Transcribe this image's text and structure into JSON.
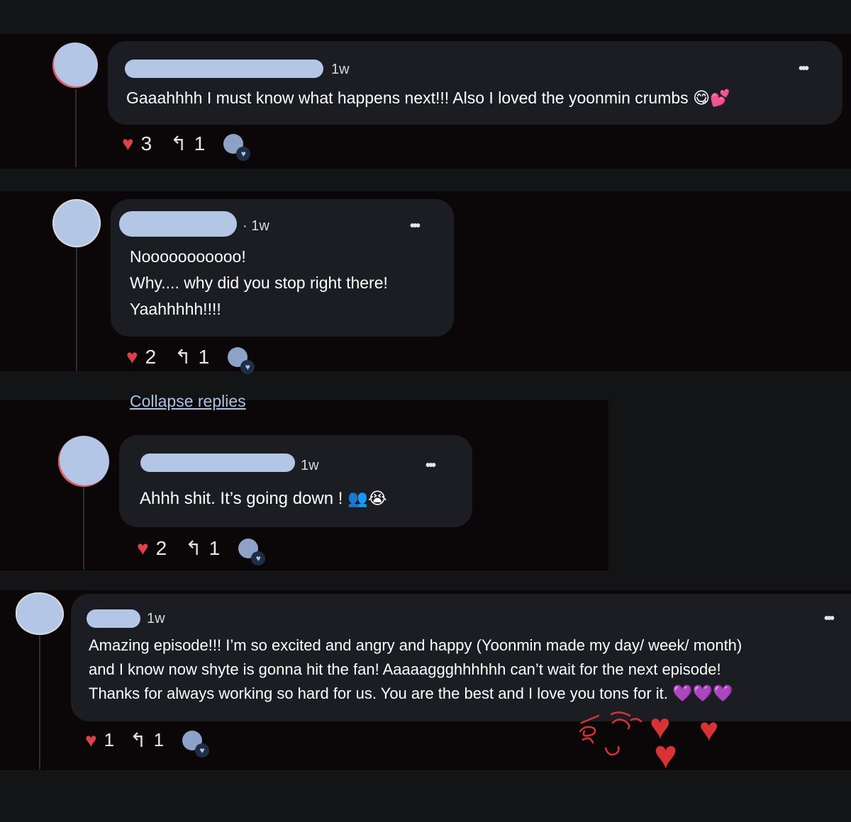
{
  "comments": [
    {
      "time": "1w",
      "text": "Gaaahhhh I must know what happens next!!! Also I loved the yoonmin crumbs",
      "emoji": "😋💕",
      "likes": "3",
      "replies": "1"
    },
    {
      "time": "· 1w",
      "lines": [
        "Nooooooooooo!",
        "Why.... why did you stop right there!",
        "Yaahhhhh!!!!"
      ],
      "likes": "2",
      "replies": "1"
    },
    {
      "time": "1w",
      "text": "Ahhh shit. It’s going down !",
      "emoji": "👥😭",
      "likes": "2",
      "replies": "1"
    },
    {
      "time": "1w",
      "lines": [
        "Amazing episode!!! I’m so excited and angry and happy (Yoonmin made my day/ week/ month)",
        "and I know now shyte is gonna hit the fan! Aaaaaggghhhhhh can’t wait for the next episode!",
        "Thanks for always working so hard for us. You are the best and I love you tons for it."
      ],
      "emoji": "💜💜💜",
      "likes": "1",
      "replies": "1"
    }
  ],
  "collapse_label": "Collapse replies",
  "more_glyph": "•••",
  "heart_glyph": "♥",
  "reply_glyph": "↰",
  "badge_glyph": "♥",
  "colors": {
    "background": "#131416",
    "band": "#0b0709",
    "bubble": "#1c1d22",
    "redaction": "#b3c6e6",
    "like_heart": "#e04146",
    "link": "#a9c2e8",
    "doodle": "#d73234"
  }
}
